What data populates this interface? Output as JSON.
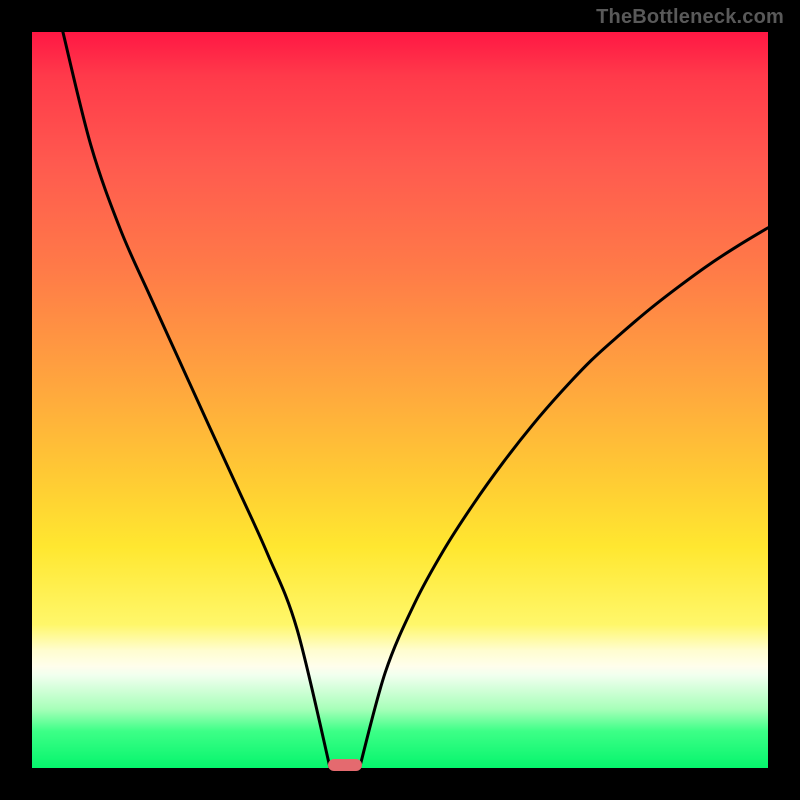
{
  "watermark_text": "TheBottleneck.com",
  "colors": {
    "curve_stroke": "#000000",
    "marker_fill": "#e46a6f"
  },
  "chart_data": {
    "type": "line",
    "title": "",
    "xlabel": "",
    "ylabel": "",
    "xlim": [
      0,
      100
    ],
    "ylim": [
      0,
      100
    ],
    "grid": false,
    "legend": false,
    "marker": {
      "x": 42.5,
      "y": 0
    },
    "series": [
      {
        "name": "left-branch",
        "x": [
          4.2,
          8.0,
          12.0,
          16.0,
          20.0,
          24.0,
          28.0,
          32.0,
          36.0,
          40.5
        ],
        "values": [
          100.0,
          84.6,
          73.2,
          64.2,
          55.4,
          46.6,
          37.9,
          29.1,
          18.9,
          0.0
        ]
      },
      {
        "name": "right-branch",
        "x": [
          44.5,
          48.0,
          52.0,
          56.0,
          60.0,
          64.0,
          68.0,
          72.0,
          76.0,
          80.0,
          84.0,
          88.0,
          92.0,
          96.0,
          100.0
        ],
        "values": [
          0.0,
          13.0,
          22.4,
          29.7,
          35.9,
          41.5,
          46.6,
          51.2,
          55.4,
          59.0,
          62.4,
          65.5,
          68.4,
          71.0,
          73.4
        ]
      }
    ]
  }
}
